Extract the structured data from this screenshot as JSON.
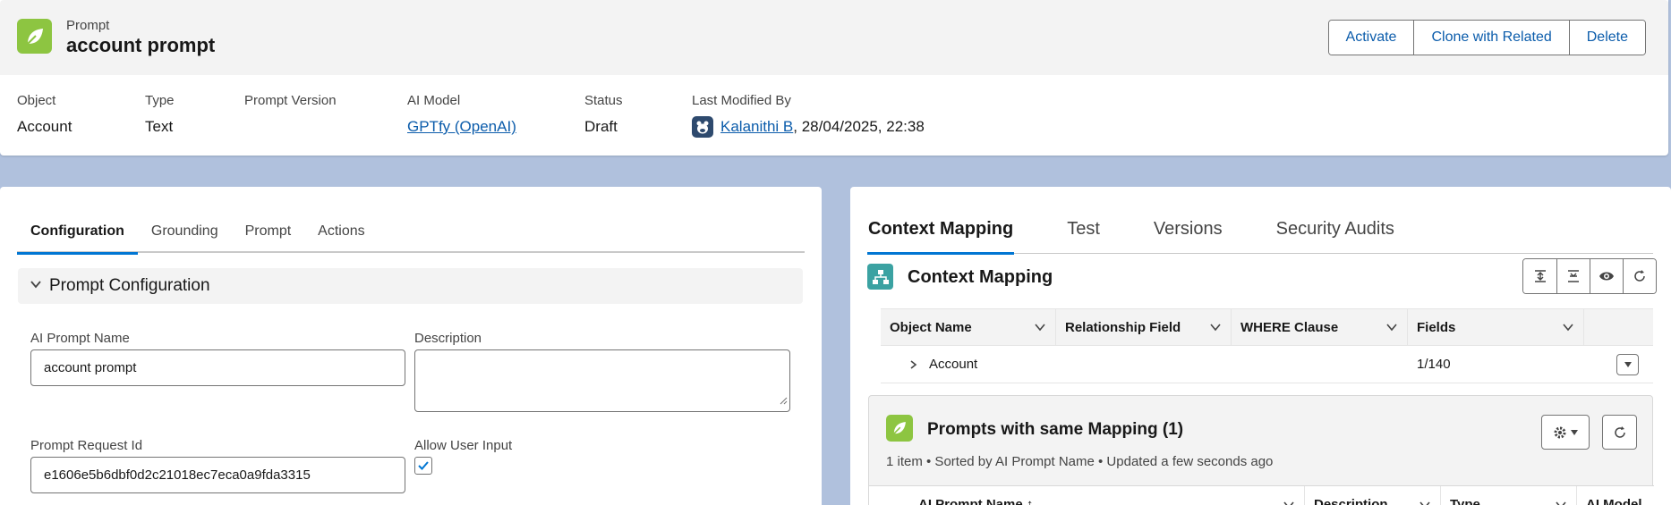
{
  "header": {
    "object_type": "Prompt",
    "title": "account prompt",
    "actions": [
      "Activate",
      "Clone with Related",
      "Delete"
    ],
    "highlights": {
      "object": {
        "label": "Object",
        "value": "Account"
      },
      "type": {
        "label": "Type",
        "value": "Text"
      },
      "prompt_version": {
        "label": "Prompt Version",
        "value": ""
      },
      "ai_model": {
        "label": "AI Model",
        "value": "GPTfy (OpenAI)"
      },
      "status": {
        "label": "Status",
        "value": "Draft"
      },
      "last_modified": {
        "label": "Last Modified By",
        "user": "Kalanithi B",
        "date": ", 28/04/2025, 22:38"
      }
    }
  },
  "left_panel": {
    "tabs": [
      "Configuration",
      "Grounding",
      "Prompt",
      "Actions"
    ],
    "active_tab": "Configuration",
    "section_title": "Prompt Configuration",
    "fields": {
      "name": {
        "label": "AI Prompt Name",
        "value": "account prompt"
      },
      "description": {
        "label": "Description",
        "value": ""
      },
      "request_id": {
        "label": "Prompt Request Id",
        "value": "e1606e5b6dbf0d2c21018ec7eca0a9fda3315"
      },
      "allow_user_input": {
        "label": "Allow User Input",
        "checked": true
      }
    }
  },
  "right_panel": {
    "tabs": [
      "Context Mapping",
      "Test",
      "Versions",
      "Security Audits"
    ],
    "active_tab": "Context Mapping",
    "context_title": "Context Mapping",
    "grid_columns": [
      "Object Name",
      "Relationship Field",
      "WHERE Clause",
      "Fields"
    ],
    "grid_rows": [
      {
        "object": "Account",
        "relationship": "",
        "where": "",
        "fields": "1/140"
      }
    ],
    "related": {
      "title": "Prompts with same Mapping (1)",
      "meta": "1 item • Sorted by AI Prompt Name • Updated a few seconds ago",
      "columns": [
        "AI Prompt Name",
        "Description",
        "Type",
        "AI Model"
      ]
    }
  },
  "colors": {
    "accent": "#0176d3",
    "link": "#0b5cab",
    "prompt_icon": "#8dc541",
    "mapping_icon": "#3ba2a2",
    "background": "#b0c1dd"
  }
}
